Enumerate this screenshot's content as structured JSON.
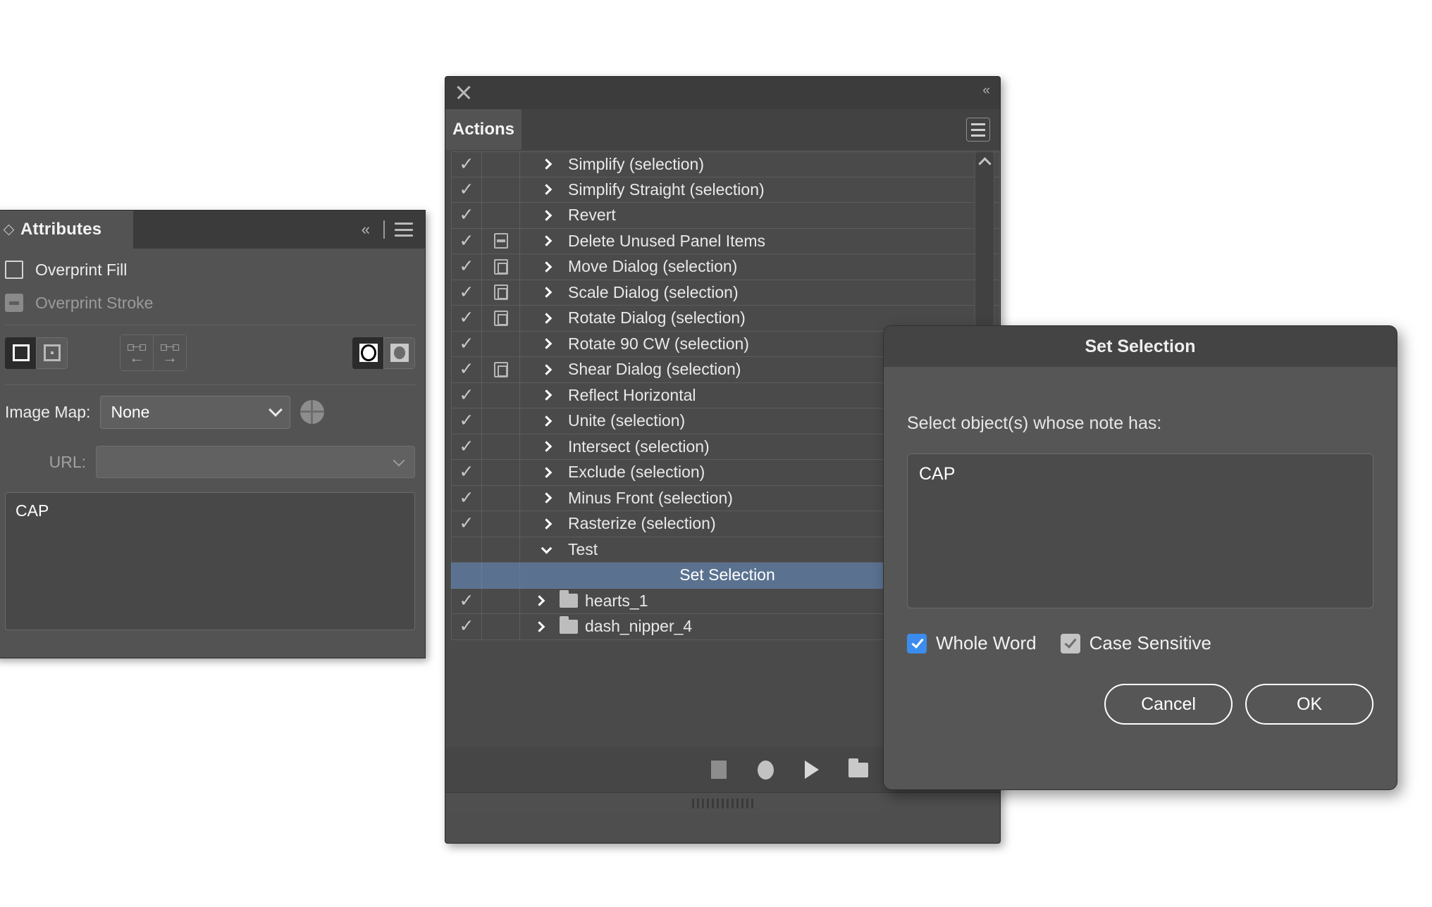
{
  "attributes_panel": {
    "tab_label": "Attributes",
    "tab_icon": "diamond-icon",
    "collapse_icon": "collapse-chevrons-icon",
    "menu_icon": "hamburger-menu-icon",
    "overprint_fill_label": "Overprint Fill",
    "overprint_fill_checked": false,
    "overprint_stroke_label": "Overprint Stroke",
    "overprint_stroke_disabled": true,
    "buttons": {
      "show_center_icon": "show-center-filled-icon",
      "hide_center_icon": "hide-center-dot-icon",
      "reverse_path_left_icon": "reverse-path-left-icon",
      "reverse_path_right_icon": "reverse-path-right-icon",
      "nonzero_fill_icon": "nonzero-fill-rule-icon",
      "evenodd_fill_icon": "evenodd-fill-rule-icon"
    },
    "image_map_label": "Image Map:",
    "image_map_value": "None",
    "image_map_options": [
      "None"
    ],
    "browser_icon": "globe-icon",
    "url_label": "URL:",
    "url_value": "",
    "note_value": "CAP"
  },
  "actions_panel": {
    "close_icon": "close-icon",
    "collapse_icon": "collapse-chevrons-icon",
    "tab_label": "Actions",
    "menu_icon": "hamburger-menu-icon",
    "scroll_up_icon": "chevron-up-icon",
    "rows": [
      {
        "checked": true,
        "dialog": "none",
        "expand": "right",
        "type": "action",
        "label": "Simplify (selection)"
      },
      {
        "checked": true,
        "dialog": "none",
        "expand": "right",
        "type": "action",
        "label": "Simplify Straight (selection)"
      },
      {
        "checked": true,
        "dialog": "none",
        "expand": "right",
        "type": "action",
        "label": "Revert"
      },
      {
        "checked": true,
        "dialog": "filled",
        "expand": "right",
        "type": "action",
        "label": "Delete Unused Panel Items"
      },
      {
        "checked": true,
        "dialog": "plain",
        "expand": "right",
        "type": "action",
        "label": "Move Dialog (selection)"
      },
      {
        "checked": true,
        "dialog": "plain",
        "expand": "right",
        "type": "action",
        "label": "Scale Dialog (selection)"
      },
      {
        "checked": true,
        "dialog": "plain",
        "expand": "right",
        "type": "action",
        "label": "Rotate Dialog (selection)"
      },
      {
        "checked": true,
        "dialog": "none",
        "expand": "right",
        "type": "action",
        "label": "Rotate 90 CW (selection)"
      },
      {
        "checked": true,
        "dialog": "plain",
        "expand": "right",
        "type": "action",
        "label": "Shear Dialog (selection)"
      },
      {
        "checked": true,
        "dialog": "none",
        "expand": "right",
        "type": "action",
        "label": "Reflect Horizontal"
      },
      {
        "checked": true,
        "dialog": "none",
        "expand": "right",
        "type": "action",
        "label": "Unite (selection)"
      },
      {
        "checked": true,
        "dialog": "none",
        "expand": "right",
        "type": "action",
        "label": "Intersect (selection)"
      },
      {
        "checked": true,
        "dialog": "none",
        "expand": "right",
        "type": "action",
        "label": "Exclude (selection)"
      },
      {
        "checked": true,
        "dialog": "none",
        "expand": "right",
        "type": "action",
        "label": "Minus Front (selection)"
      },
      {
        "checked": true,
        "dialog": "none",
        "expand": "right",
        "type": "action",
        "label": "Rasterize (selection)"
      },
      {
        "checked": false,
        "dialog": "none",
        "expand": "down",
        "type": "action",
        "label": "Test"
      },
      {
        "checked": false,
        "dialog": "none",
        "expand": "none",
        "type": "step",
        "selected": true,
        "label": "Set Selection"
      },
      {
        "checked": true,
        "dialog": "none",
        "expand": "right",
        "type": "set",
        "label": "hearts_1"
      },
      {
        "checked": true,
        "dialog": "none",
        "expand": "right",
        "type": "set",
        "label": "dash_nipper_4"
      }
    ],
    "toolbar": [
      {
        "name": "stop-button",
        "icon": "stop-icon"
      },
      {
        "name": "record-button",
        "icon": "record-icon"
      },
      {
        "name": "play-button",
        "icon": "play-icon"
      },
      {
        "name": "create-new-set-button",
        "icon": "folder-icon"
      },
      {
        "name": "create-new-action-button",
        "icon": "new-action-icon"
      },
      {
        "name": "delete-button",
        "icon": "trash-icon"
      }
    ]
  },
  "set_selection_dialog": {
    "title": "Set Selection",
    "prompt": "Select object(s) whose note has:",
    "note_value": "CAP",
    "whole_word_label": "Whole Word",
    "whole_word_checked": true,
    "case_sensitive_label": "Case Sensitive",
    "case_sensitive_checked": true,
    "cancel_label": "Cancel",
    "ok_label": "OK",
    "accent_color": "#3b8ced",
    "selection_color": "#5a7290"
  }
}
